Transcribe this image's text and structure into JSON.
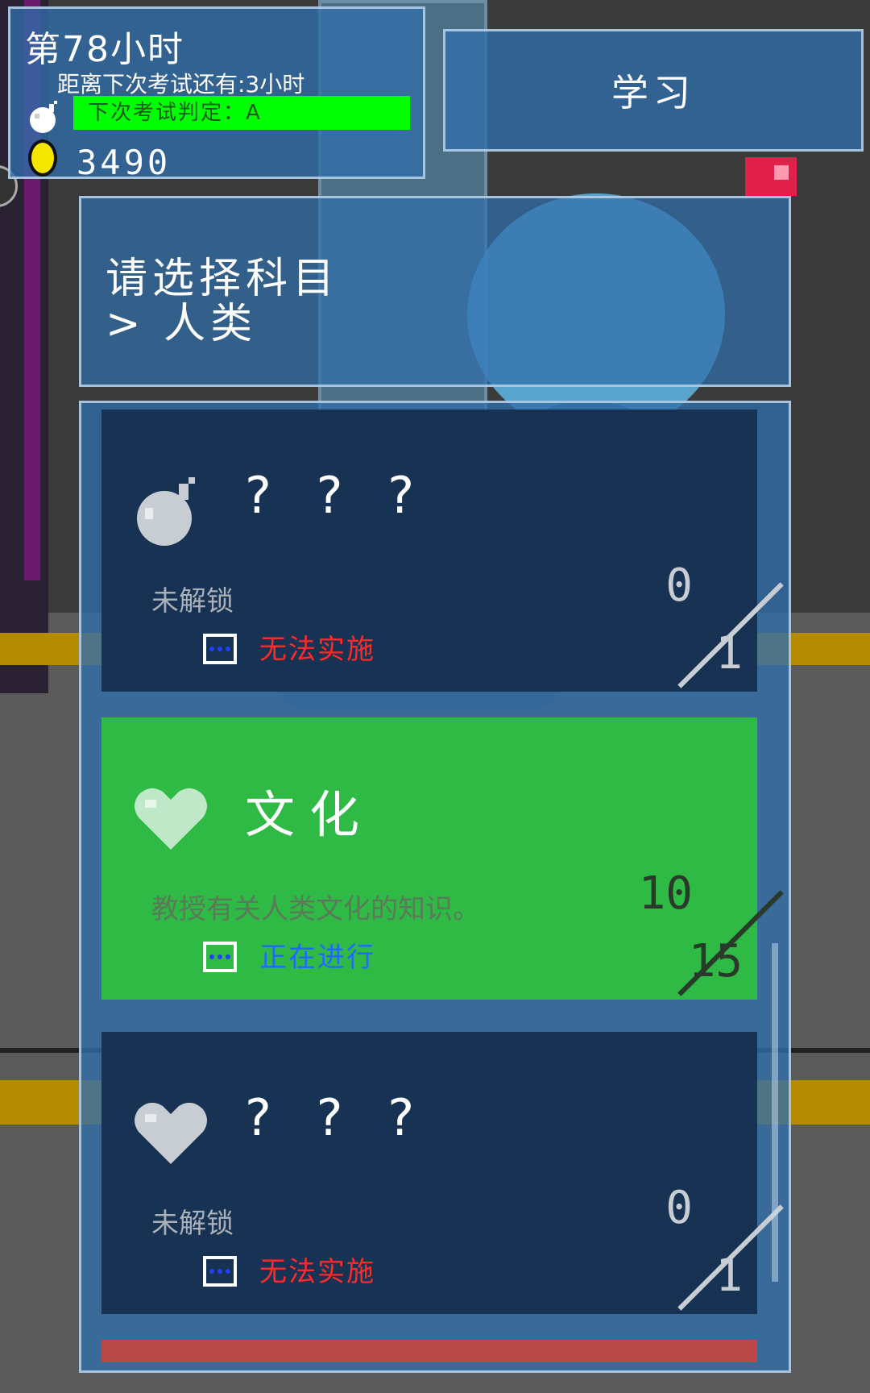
{
  "hud": {
    "hour_title": "第78小时",
    "countdown": "距离下次考试还有:3小时",
    "judge": "下次考试判定：A",
    "coins": "3490",
    "bar_color": "#00ff00"
  },
  "study_button": {
    "label": "学习"
  },
  "subject": {
    "prompt": "请选择科目",
    "path": "> 人类"
  },
  "cards": [
    {
      "icon": "bomb-icon",
      "title": "? ? ?",
      "desc": "未解锁",
      "status": "无法实施",
      "progress_num": "0",
      "progress_den": "1",
      "state": "locked"
    },
    {
      "icon": "heart-icon",
      "title": "文化",
      "desc": "教授有关人类文化的知识。",
      "status": "正在进行",
      "progress_num": "10",
      "progress_den": "15",
      "state": "active"
    },
    {
      "icon": "heart-icon",
      "title": "? ? ?",
      "desc": "未解锁",
      "status": "无法实施",
      "progress_num": "0",
      "progress_den": "1",
      "state": "locked"
    }
  ],
  "colors": {
    "panel": "#316eaa",
    "locked_card": "#173252",
    "active_card": "#2fba45",
    "status_bad": "#ff2a2a",
    "status_good": "#1f6aff",
    "bottom_bar": "#b84848"
  }
}
